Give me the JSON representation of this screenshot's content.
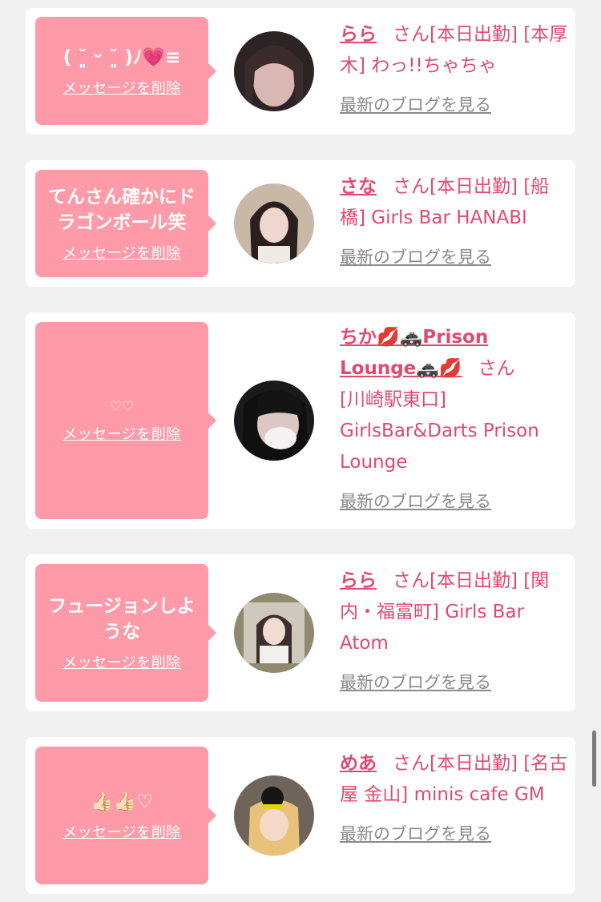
{
  "delete_label": "メッセージを削除",
  "blog_label": "最新のブログを見る",
  "san": "さん",
  "cards": [
    {
      "message": "( ˘͈ ᵕ ˘͈ )ﾉ💗≡",
      "name": "らら",
      "detail": "[本日出勤] [本厚木] わっ!!ちゃちゃ"
    },
    {
      "message": "てんさん確かにドラゴンボール笑",
      "name": "さな",
      "detail": "[本日出勤] [船橋] Girls Bar HANABI"
    },
    {
      "message": "♡♡",
      "name": "ちか💋🚓Prison Lounge🚓💋",
      "detail": "[川崎駅東口] GirlsBar&Darts Prison Lounge"
    },
    {
      "message": "フュージョンしような",
      "name": "らら",
      "detail": "[本日出勤] [関内・福富町] Girls Bar Atom"
    },
    {
      "message": "👍🏻👍🏻♡",
      "name": "めあ",
      "detail": "[本日出勤] [名古屋 金山] minis cafe GM"
    }
  ]
}
